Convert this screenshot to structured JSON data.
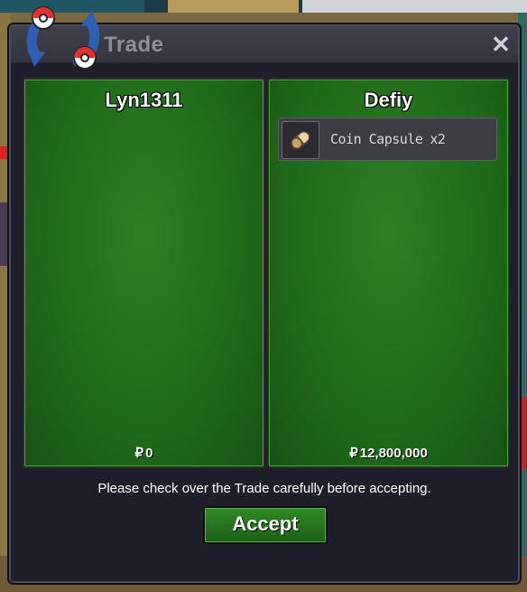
{
  "window": {
    "title": "Trade",
    "close_label": "✕"
  },
  "left_party": {
    "name": "Lyn1311",
    "currency_symbol": "₽",
    "money": "0"
  },
  "right_party": {
    "name": "Defiy",
    "currency_symbol": "₽",
    "money": "12,800,000",
    "items": [
      {
        "name": "Coin Capsule",
        "quantity": "x2",
        "icon": "coin-capsule-icon"
      }
    ]
  },
  "footer": {
    "warning": "Please check over the Trade carefully before accepting.",
    "accept_label": "Accept"
  },
  "colors": {
    "panel_green": "#2f7f24",
    "window_bg": "#1f1f2c",
    "accept_green": "#2f8b25"
  }
}
